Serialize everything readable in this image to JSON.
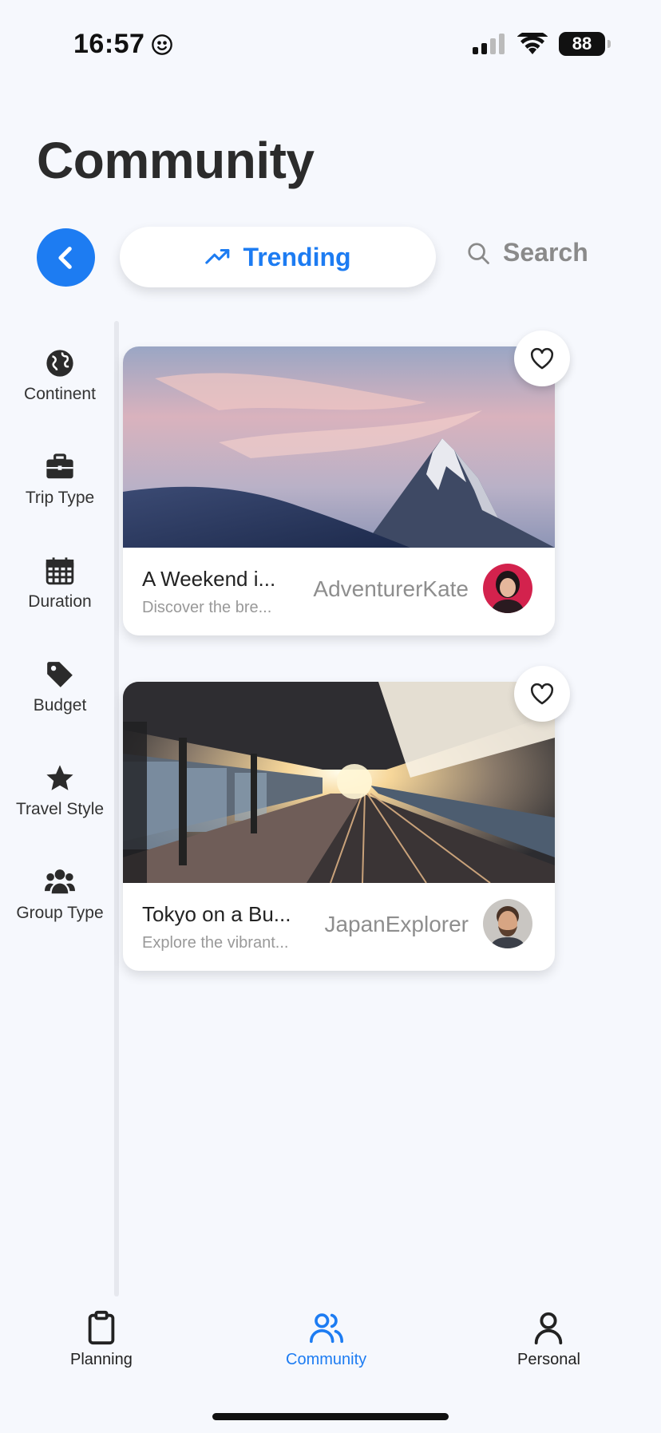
{
  "status": {
    "time": "16:57",
    "battery": "88"
  },
  "page": {
    "title": "Community"
  },
  "nav": {
    "trending_label": "Trending",
    "search_label": "Search"
  },
  "sidebar": {
    "items": [
      {
        "label": "Continent",
        "icon": "globe-icon"
      },
      {
        "label": "Trip Type",
        "icon": "briefcase-icon"
      },
      {
        "label": "Duration",
        "icon": "calendar-icon"
      },
      {
        "label": "Budget",
        "icon": "tag-icon"
      },
      {
        "label": "Travel Style",
        "icon": "star-icon"
      },
      {
        "label": "Group Type",
        "icon": "users-icon"
      }
    ]
  },
  "posts": [
    {
      "title": "A Weekend i...",
      "description": "Discover the bre...",
      "author": "AdventurerKate"
    },
    {
      "title": "Tokyo on a Bu...",
      "description": "Explore the vibrant...",
      "author": "JapanExplorer"
    }
  ],
  "tabs": [
    {
      "label": "Planning",
      "icon": "clipboard-icon"
    },
    {
      "label": "Community",
      "icon": "users-icon",
      "active": true
    },
    {
      "label": "Personal",
      "icon": "person-icon"
    }
  ],
  "colors": {
    "accent": "#1d7cf2",
    "background": "#f6f8fd"
  }
}
